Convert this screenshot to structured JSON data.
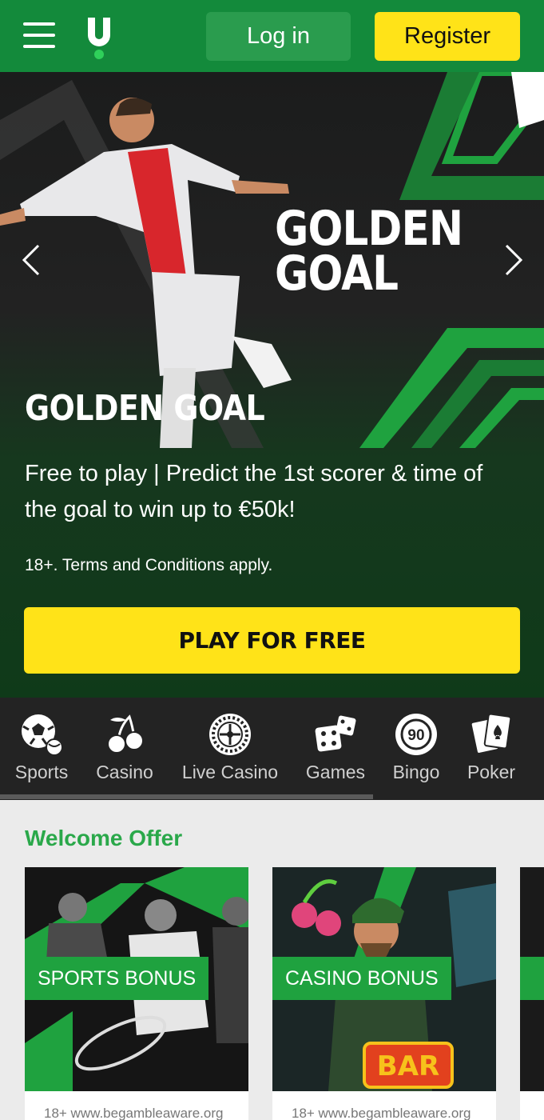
{
  "header": {
    "login_label": "Log in",
    "register_label": "Register",
    "brand_color": "#138a3b",
    "accent_color": "#ffe318"
  },
  "hero": {
    "logo_line1": "GOLDEN",
    "logo_line2": "GOAL",
    "title": "GOLDEN GOAL",
    "description": "Free to play | Predict the 1st scorer & time of the goal to win up to €50k!",
    "terms": "18+. Terms and Conditions apply.",
    "cta_label": "PLAY FOR FREE"
  },
  "categories": [
    {
      "label": "Sports",
      "icon": "soccer-ball-icon"
    },
    {
      "label": "Casino",
      "icon": "cherries-icon"
    },
    {
      "label": "Live Casino",
      "icon": "roulette-wheel-icon"
    },
    {
      "label": "Games",
      "icon": "dice-icon"
    },
    {
      "label": "Bingo",
      "icon": "bingo-ball-icon"
    },
    {
      "label": "Poker",
      "icon": "playing-cards-icon"
    }
  ],
  "bingo_number": "90",
  "offers": {
    "title": "Welcome Offer",
    "cards": [
      {
        "tag": "SPORTS BONUS",
        "footer": "18+ www.begambleaware.org"
      },
      {
        "tag": "CASINO BONUS",
        "footer": "18+ www.begambleaware.org"
      }
    ],
    "slot_symbol": "BAR"
  }
}
